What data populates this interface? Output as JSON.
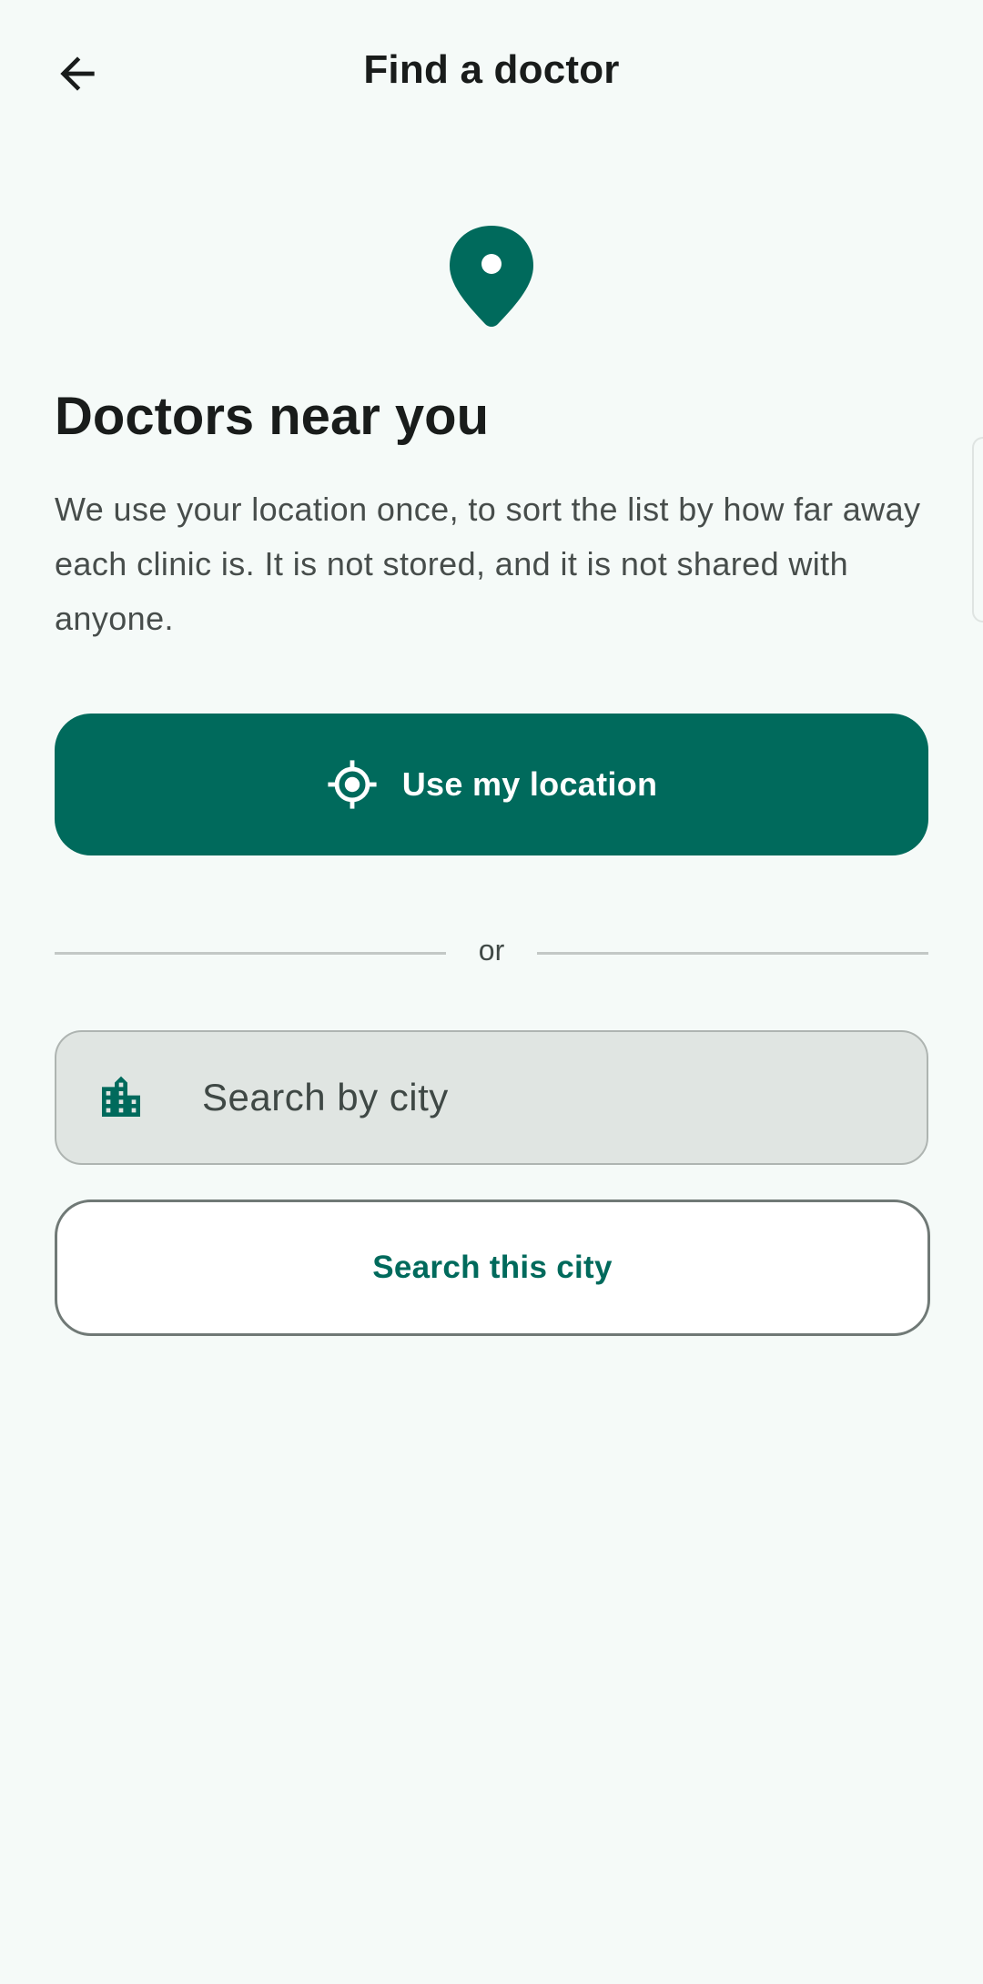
{
  "header": {
    "title": "Find a doctor",
    "back_icon": "arrow-back-icon"
  },
  "intro": {
    "icon": "location-pin-icon",
    "heading": "Doctors near you",
    "description": "We use your location once, to sort the list by how far away each clinic is. It is not stored, and it is not shared with anyone."
  },
  "location_button": {
    "icon": "my-location-icon",
    "label": "Use my location"
  },
  "divider": {
    "text": "or"
  },
  "city_search": {
    "icon": "city-icon",
    "placeholder": "Search by city",
    "value": ""
  },
  "search_button": {
    "label": "Search this city"
  },
  "colors": {
    "background": "#f5faf8",
    "primary": "#006a5c",
    "on_primary": "#ffffff",
    "field_background": "#e0e5e2",
    "text": "#191c1b",
    "secondary_text": "#474d4b"
  }
}
